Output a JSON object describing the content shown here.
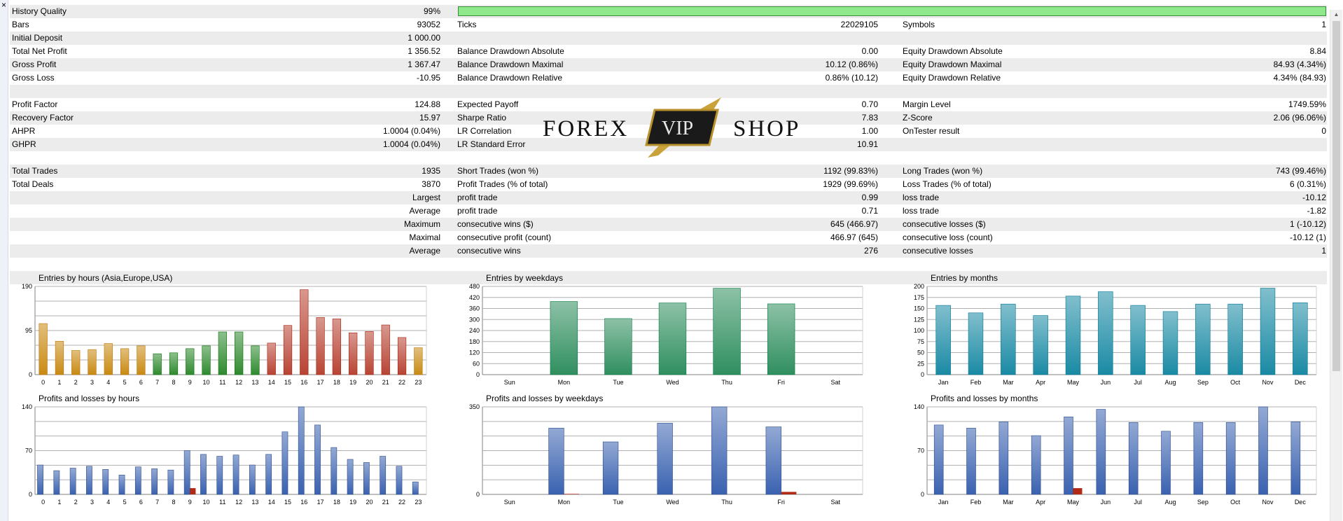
{
  "window": {
    "close_glyph": "×"
  },
  "summary": [
    {
      "alt": true,
      "quality_bar": true,
      "cells": [
        {
          "x": 3,
          "text": "History Quality"
        },
        {
          "x": 425,
          "w": 190,
          "align": "right",
          "text": "99%"
        }
      ]
    },
    {
      "alt": false,
      "cells": [
        {
          "x": 3,
          "text": "Bars"
        },
        {
          "x": 425,
          "w": 190,
          "align": "right",
          "text": "93052"
        },
        {
          "x": 639,
          "text": "Ticks"
        },
        {
          "x": 1050,
          "w": 190,
          "align": "right",
          "text": "22029105"
        },
        {
          "x": 1275,
          "text": "Symbols"
        },
        {
          "x": 1670,
          "w": 210,
          "align": "right",
          "text": "1"
        }
      ]
    },
    {
      "alt": true,
      "cells": [
        {
          "x": 3,
          "text": "Initial Deposit"
        },
        {
          "x": 425,
          "w": 190,
          "align": "right",
          "text": "1 000.00"
        }
      ]
    },
    {
      "alt": false,
      "cells": [
        {
          "x": 3,
          "text": "Total Net Profit"
        },
        {
          "x": 425,
          "w": 190,
          "align": "right",
          "text": "1 356.52"
        },
        {
          "x": 639,
          "text": "Balance Drawdown Absolute"
        },
        {
          "x": 1050,
          "w": 190,
          "align": "right",
          "text": "0.00"
        },
        {
          "x": 1275,
          "text": "Equity Drawdown Absolute"
        },
        {
          "x": 1670,
          "w": 210,
          "align": "right",
          "text": "8.84"
        }
      ]
    },
    {
      "alt": true,
      "cells": [
        {
          "x": 3,
          "text": "Gross Profit"
        },
        {
          "x": 425,
          "w": 190,
          "align": "right",
          "text": "1 367.47"
        },
        {
          "x": 639,
          "text": "Balance Drawdown Maximal"
        },
        {
          "x": 1050,
          "w": 190,
          "align": "right",
          "text": "10.12 (0.86%)"
        },
        {
          "x": 1275,
          "text": "Equity Drawdown Maximal"
        },
        {
          "x": 1670,
          "w": 210,
          "align": "right",
          "text": "84.93 (4.34%)"
        }
      ]
    },
    {
      "alt": false,
      "cells": [
        {
          "x": 3,
          "text": "Gross Loss"
        },
        {
          "x": 425,
          "w": 190,
          "align": "right",
          "text": "-10.95"
        },
        {
          "x": 639,
          "text": "Balance Drawdown Relative"
        },
        {
          "x": 1050,
          "w": 190,
          "align": "right",
          "text": "0.86% (10.12)"
        },
        {
          "x": 1275,
          "text": "Equity Drawdown Relative"
        },
        {
          "x": 1670,
          "w": 210,
          "align": "right",
          "text": "4.34% (84.93)"
        }
      ]
    },
    {
      "alt": true,
      "cells": []
    },
    {
      "alt": false,
      "cells": [
        {
          "x": 3,
          "text": "Profit Factor"
        },
        {
          "x": 425,
          "w": 190,
          "align": "right",
          "text": "124.88"
        },
        {
          "x": 639,
          "text": "Expected Payoff"
        },
        {
          "x": 1050,
          "w": 190,
          "align": "right",
          "text": "0.70"
        },
        {
          "x": 1275,
          "text": "Margin Level"
        },
        {
          "x": 1670,
          "w": 210,
          "align": "right",
          "text": "1749.59%"
        }
      ]
    },
    {
      "alt": true,
      "cells": [
        {
          "x": 3,
          "text": "Recovery Factor"
        },
        {
          "x": 425,
          "w": 190,
          "align": "right",
          "text": "15.97"
        },
        {
          "x": 639,
          "text": "Sharpe Ratio"
        },
        {
          "x": 1050,
          "w": 190,
          "align": "right",
          "text": "7.83"
        },
        {
          "x": 1275,
          "text": "Z-Score"
        },
        {
          "x": 1670,
          "w": 210,
          "align": "right",
          "text": "2.06 (96.06%)"
        }
      ]
    },
    {
      "alt": false,
      "cells": [
        {
          "x": 3,
          "text": "AHPR"
        },
        {
          "x": 425,
          "w": 190,
          "align": "right",
          "text": "1.0004 (0.04%)"
        },
        {
          "x": 639,
          "text": "LR Correlation"
        },
        {
          "x": 1050,
          "w": 190,
          "align": "right",
          "text": "1.00"
        },
        {
          "x": 1275,
          "text": "OnTester result"
        },
        {
          "x": 1670,
          "w": 210,
          "align": "right",
          "text": "0"
        }
      ]
    },
    {
      "alt": true,
      "cells": [
        {
          "x": 3,
          "text": "GHPR"
        },
        {
          "x": 425,
          "w": 190,
          "align": "right",
          "text": "1.0004 (0.04%)"
        },
        {
          "x": 639,
          "text": "LR Standard Error"
        },
        {
          "x": 1050,
          "w": 190,
          "align": "right",
          "text": "10.91"
        }
      ]
    },
    {
      "alt": false,
      "cells": []
    },
    {
      "alt": true,
      "cells": [
        {
          "x": 3,
          "text": "Total Trades"
        },
        {
          "x": 425,
          "w": 190,
          "align": "right",
          "text": "1935"
        },
        {
          "x": 639,
          "text": "Short Trades (won %)"
        },
        {
          "x": 1050,
          "w": 190,
          "align": "right",
          "text": "1192 (99.83%)"
        },
        {
          "x": 1275,
          "text": "Long Trades (won %)"
        },
        {
          "x": 1670,
          "w": 210,
          "align": "right",
          "text": "743 (99.46%)"
        }
      ]
    },
    {
      "alt": false,
      "cells": [
        {
          "x": 3,
          "text": "Total Deals"
        },
        {
          "x": 425,
          "w": 190,
          "align": "right",
          "text": "3870"
        },
        {
          "x": 639,
          "text": "Profit Trades (% of total)"
        },
        {
          "x": 1050,
          "w": 190,
          "align": "right",
          "text": "1929 (99.69%)"
        },
        {
          "x": 1275,
          "text": "Loss Trades (% of total)"
        },
        {
          "x": 1670,
          "w": 210,
          "align": "right",
          "text": "6 (0.31%)"
        }
      ]
    },
    {
      "alt": true,
      "cells": [
        {
          "x": 425,
          "w": 190,
          "align": "right",
          "text": "Largest"
        },
        {
          "x": 639,
          "text": "profit trade"
        },
        {
          "x": 1050,
          "w": 190,
          "align": "right",
          "text": "0.99"
        },
        {
          "x": 1275,
          "text": "loss trade"
        },
        {
          "x": 1670,
          "w": 210,
          "align": "right",
          "text": "-10.12"
        }
      ]
    },
    {
      "alt": false,
      "cells": [
        {
          "x": 425,
          "w": 190,
          "align": "right",
          "text": "Average"
        },
        {
          "x": 639,
          "text": "profit trade"
        },
        {
          "x": 1050,
          "w": 190,
          "align": "right",
          "text": "0.71"
        },
        {
          "x": 1275,
          "text": "loss trade"
        },
        {
          "x": 1670,
          "w": 210,
          "align": "right",
          "text": "-1.82"
        }
      ]
    },
    {
      "alt": true,
      "cells": [
        {
          "x": 425,
          "w": 190,
          "align": "right",
          "text": "Maximum"
        },
        {
          "x": 639,
          "text": "consecutive wins ($)"
        },
        {
          "x": 1050,
          "w": 190,
          "align": "right",
          "text": "645 (466.97)"
        },
        {
          "x": 1275,
          "text": "consecutive losses ($)"
        },
        {
          "x": 1670,
          "w": 210,
          "align": "right",
          "text": "1 (-10.12)"
        }
      ]
    },
    {
      "alt": false,
      "cells": [
        {
          "x": 425,
          "w": 190,
          "align": "right",
          "text": "Maximal"
        },
        {
          "x": 639,
          "text": "consecutive profit (count)"
        },
        {
          "x": 1050,
          "w": 190,
          "align": "right",
          "text": "466.97 (645)"
        },
        {
          "x": 1275,
          "text": "consecutive loss (count)"
        },
        {
          "x": 1670,
          "w": 210,
          "align": "right",
          "text": "-10.12 (1)"
        }
      ]
    },
    {
      "alt": true,
      "cells": [
        {
          "x": 425,
          "w": 190,
          "align": "right",
          "text": "Average"
        },
        {
          "x": 639,
          "text": "consecutive wins"
        },
        {
          "x": 1050,
          "w": 190,
          "align": "right",
          "text": "276"
        },
        {
          "x": 1275,
          "text": "consecutive losses"
        },
        {
          "x": 1670,
          "w": 210,
          "align": "right",
          "text": "1"
        }
      ]
    },
    {
      "alt": false,
      "cells": []
    },
    {
      "alt": true,
      "cells": []
    }
  ],
  "watermark": {
    "left": "FOREX",
    "center": "VIP",
    "right": "SHOP"
  },
  "chart_data": [
    {
      "type": "bar",
      "title": "Entries by hours (Asia,Europe,USA)",
      "categories": [
        "0",
        "1",
        "2",
        "3",
        "4",
        "5",
        "6",
        "7",
        "8",
        "9",
        "10",
        "11",
        "12",
        "13",
        "14",
        "15",
        "16",
        "17",
        "18",
        "19",
        "20",
        "21",
        "22",
        "23"
      ],
      "values": [
        110,
        72,
        52,
        54,
        67,
        56,
        62,
        45,
        47,
        56,
        62,
        92,
        92,
        62,
        68,
        106,
        183,
        123,
        120,
        90,
        93,
        107,
        80,
        58
      ],
      "ylim": [
        0,
        190
      ],
      "yticks": [
        0,
        95,
        190
      ],
      "colors": [
        "#c98a12",
        "#c98a12",
        "#c98a12",
        "#c98a12",
        "#c98a12",
        "#c98a12",
        "#c98a12",
        "#2f8a2f",
        "#2f8a2f",
        "#2f8a2f",
        "#2f8a2f",
        "#2f8a2f",
        "#2f8a2f",
        "#2f8a2f",
        "#b84434",
        "#b84434",
        "#b84434",
        "#b84434",
        "#b84434",
        "#b84434",
        "#b84434",
        "#b84434",
        "#b84434",
        "#c98a12"
      ]
    },
    {
      "type": "bar",
      "title": "Entries by weekdays",
      "categories": [
        "Sun",
        "Mon",
        "Tue",
        "Wed",
        "Thu",
        "Fri",
        "Sat"
      ],
      "values": [
        0,
        398,
        305,
        390,
        470,
        385,
        0
      ],
      "ylim": [
        0,
        480
      ],
      "yticks": [
        0,
        60,
        120,
        180,
        240,
        300,
        360,
        420,
        480
      ],
      "color": "#2f8f5f"
    },
    {
      "type": "bar",
      "title": "Entries by months",
      "categories": [
        "Jan",
        "Feb",
        "Mar",
        "Apr",
        "May",
        "Jun",
        "Jul",
        "Aug",
        "Sep",
        "Oct",
        "Nov",
        "Dec"
      ],
      "values": [
        157,
        140,
        160,
        134,
        178,
        188,
        157,
        143,
        160,
        160,
        196,
        163
      ],
      "ylim": [
        0,
        200
      ],
      "yticks": [
        0,
        25,
        50,
        75,
        100,
        125,
        150,
        175,
        200
      ],
      "color": "#1a8aa4"
    },
    {
      "type": "bar",
      "title": "Profits and losses by hours",
      "categories": [
        "0",
        "1",
        "2",
        "3",
        "4",
        "5",
        "6",
        "7",
        "8",
        "9",
        "10",
        "11",
        "12",
        "13",
        "14",
        "15",
        "16",
        "17",
        "18",
        "19",
        "20",
        "21",
        "22",
        "23"
      ],
      "series": [
        {
          "values": [
            47,
            38,
            42,
            45,
            40,
            31,
            44,
            41,
            39,
            70,
            64,
            61,
            63,
            47,
            64,
            100,
            140,
            111,
            75,
            56,
            51,
            61,
            45,
            20
          ]
        },
        {
          "values": [
            0,
            0,
            0,
            0,
            0,
            0,
            0,
            0,
            0,
            10,
            0,
            0,
            0,
            0,
            0,
            0,
            0,
            0,
            0,
            0,
            0,
            0,
            0,
            0
          ]
        }
      ],
      "ylim": [
        0,
        140
      ],
      "yticks": [
        0,
        70,
        140
      ],
      "colors": {
        "profit": "#3a62b0",
        "loss": "#b02a16"
      }
    },
    {
      "type": "bar",
      "title": "Profits and losses by weekdays",
      "categories": [
        "Sun",
        "Mon",
        "Tue",
        "Wed",
        "Thu",
        "Fri",
        "Sat"
      ],
      "series": [
        {
          "values": [
            0,
            265,
            210,
            285,
            350,
            270,
            0
          ]
        },
        {
          "values": [
            0,
            2,
            0,
            0,
            0,
            10,
            0
          ]
        }
      ],
      "ylim": [
        0,
        350
      ],
      "yticks": [
        0,
        350
      ],
      "colors": {
        "profit": "#3a62b0",
        "loss": "#b02a16"
      }
    },
    {
      "type": "bar",
      "title": "Profits and losses by months",
      "categories": [
        "Jan",
        "Feb",
        "Mar",
        "Apr",
        "May",
        "Jun",
        "Jul",
        "Aug",
        "Sep",
        "Oct",
        "Nov",
        "Dec"
      ],
      "series": [
        {
          "values": [
            111,
            106,
            116,
            94,
            124,
            136,
            115,
            101,
            115,
            115,
            140,
            116
          ]
        },
        {
          "values": [
            0,
            0,
            0,
            0,
            10,
            0,
            0,
            0,
            0,
            0,
            0,
            0
          ]
        }
      ],
      "ylim": [
        0,
        140
      ],
      "yticks": [
        0,
        70,
        140
      ],
      "colors": {
        "profit": "#3a62b0",
        "loss": "#b02a16"
      }
    }
  ]
}
